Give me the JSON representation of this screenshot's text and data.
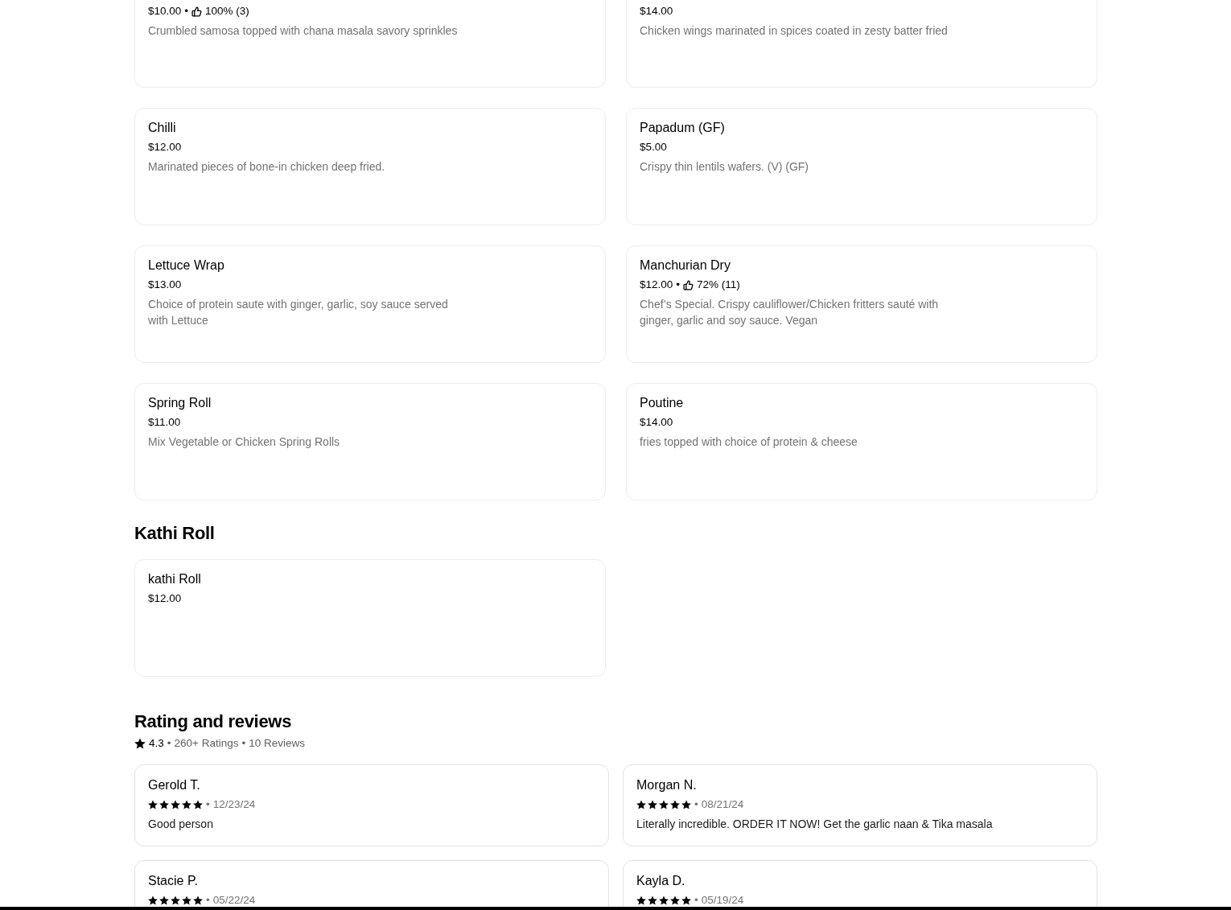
{
  "menu_sections": [
    {
      "items": [
        {
          "price": "$10.00",
          "separator": "•",
          "likes": "100% (3)",
          "description": "Crumbled samosa topped with chana masala savory sprinkles"
        },
        {
          "price": "$14.00",
          "description": "Chicken wings marinated in spices coated in zesty batter fried"
        },
        {
          "name": "Chilli",
          "price": "$12.00",
          "description": "Marinated pieces of bone-in chicken deep fried."
        },
        {
          "name": "Papadum (GF)",
          "price": "$5.00",
          "description": "Crispy thin lentils wafers. (V) (GF)"
        },
        {
          "name": "Lettuce Wrap",
          "price": "$13.00",
          "description": "Choice of protein saute with ginger, garlic, soy sauce served with Lettuce"
        },
        {
          "name": "Manchurian Dry",
          "price": "$12.00",
          "separator": "•",
          "likes": "72% (11)",
          "description": "Chef’s Special. Crispy cauliflower/Chicken fritters sauté with ginger, garlic and soy sauce. Vegan"
        },
        {
          "name": "Spring Roll",
          "price": "$11.00",
          "description": "Mix Vegetable or Chicken Spring Rolls"
        },
        {
          "name": "Poutine",
          "price": "$14.00",
          "description": "fries topped with choice of protein & cheese"
        }
      ]
    },
    {
      "title": "Kathi Roll",
      "items": [
        {
          "name": "kathi Roll",
          "price": "$12.00"
        }
      ]
    }
  ],
  "reviews_section": {
    "title": "Rating and reviews",
    "summary": {
      "score": "4.3",
      "separator_1": "•",
      "ratings": "260+ Ratings",
      "separator_2": "•",
      "reviews": "10 Reviews"
    },
    "reviews": [
      {
        "name": "Gerold T.",
        "stars": 5,
        "separator": "•",
        "date": "12/23/24",
        "text": "Good person"
      },
      {
        "name": "Morgan N.",
        "stars": 5,
        "separator": "•",
        "date": "08/21/24",
        "text": "Literally incredible. ORDER IT NOW! Get the garlic naan & Tika masala"
      },
      {
        "name": "Stacie P.",
        "stars": 5,
        "separator": "•",
        "date": "05/22/24"
      },
      {
        "name": "Kayla D.",
        "stars": 5,
        "separator": "•",
        "date": "05/19/24"
      }
    ]
  }
}
